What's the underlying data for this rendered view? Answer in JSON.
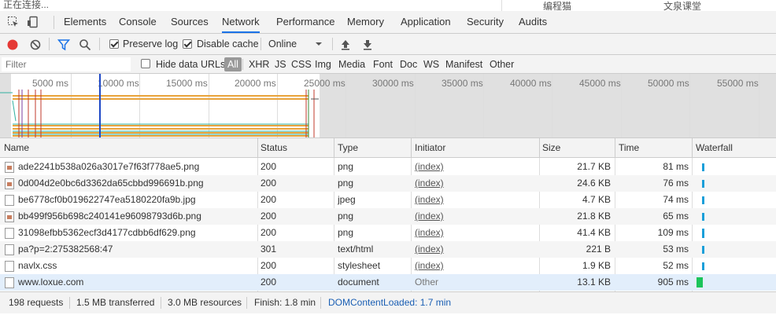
{
  "browser": {
    "status_text": "正在连接...",
    "bookmark_1": "编程猫",
    "bookmark_2": "文泉课堂"
  },
  "tabs": [
    {
      "label": "Elements"
    },
    {
      "label": "Console"
    },
    {
      "label": "Sources"
    },
    {
      "label": "Network",
      "active": true
    },
    {
      "label": "Performance"
    },
    {
      "label": "Memory"
    },
    {
      "label": "Application"
    },
    {
      "label": "Security"
    },
    {
      "label": "Audits"
    }
  ],
  "toolbar": {
    "preserve_log": "Preserve log",
    "disable_cache": "Disable cache",
    "throttle": "Online",
    "record_color": "#e53935"
  },
  "filterbar": {
    "placeholder": "Filter",
    "hide_data_urls": "Hide data URLs",
    "types": [
      "All",
      "XHR",
      "JS",
      "CSS",
      "Img",
      "Media",
      "Font",
      "Doc",
      "WS",
      "Manifest",
      "Other"
    ]
  },
  "overview": {
    "ticks": [
      "5000 ms",
      "10000 ms",
      "15000 ms",
      "20000 ms",
      "25000 ms",
      "30000 ms",
      "35000 ms",
      "40000 ms",
      "45000 ms",
      "50000 ms",
      "55000 ms"
    ]
  },
  "table": {
    "columns": [
      "Name",
      "Status",
      "Type",
      "Initiator",
      "Size",
      "Time",
      "Waterfall"
    ],
    "rows": [
      {
        "name": "ade2241b538a026a3017e7f63f778ae5.png",
        "status": "200",
        "type": "png",
        "initiator": "(index)",
        "size": "21.7 KB",
        "time": "81 ms",
        "icon": "img"
      },
      {
        "name": "0d004d2e0bc6d3362da65cbbd996691b.png",
        "status": "200",
        "type": "png",
        "initiator": "(index)",
        "size": "24.6 KB",
        "time": "76 ms",
        "icon": "img"
      },
      {
        "name": "be6778cf0b019622747ea5180220fa9b.jpg",
        "status": "200",
        "type": "jpeg",
        "initiator": "(index)",
        "size": "4.7 KB",
        "time": "74 ms",
        "icon": "doc"
      },
      {
        "name": "bb499f956b698c240141e96098793d6b.png",
        "status": "200",
        "type": "png",
        "initiator": "(index)",
        "size": "21.8 KB",
        "time": "65 ms",
        "icon": "img"
      },
      {
        "name": "31098efbb5362ecf3d4177cdbb6df629.png",
        "status": "200",
        "type": "png",
        "initiator": "(index)",
        "size": "41.4 KB",
        "time": "109 ms",
        "icon": "doc"
      },
      {
        "name": "pa?p=2:275382568:47",
        "status": "301",
        "type": "text/html",
        "initiator": "(index)",
        "size": "221 B",
        "time": "53 ms",
        "icon": "doc"
      },
      {
        "name": "navlx.css",
        "status": "200",
        "type": "stylesheet",
        "initiator": "(index)",
        "size": "1.9 KB",
        "time": "52 ms",
        "icon": "doc"
      },
      {
        "name": "www.loxue.com",
        "status": "200",
        "type": "document",
        "initiator": "Other",
        "size": "13.1 KB",
        "time": "905 ms",
        "icon": "doc"
      }
    ]
  },
  "statusbar": {
    "requests": "198 requests",
    "transferred": "1.5 MB transferred",
    "resources": "3.0 MB resources",
    "finish": "Finish: 1.8 min",
    "dom_loaded": "DOMContentLoaded: 1.7 min"
  }
}
